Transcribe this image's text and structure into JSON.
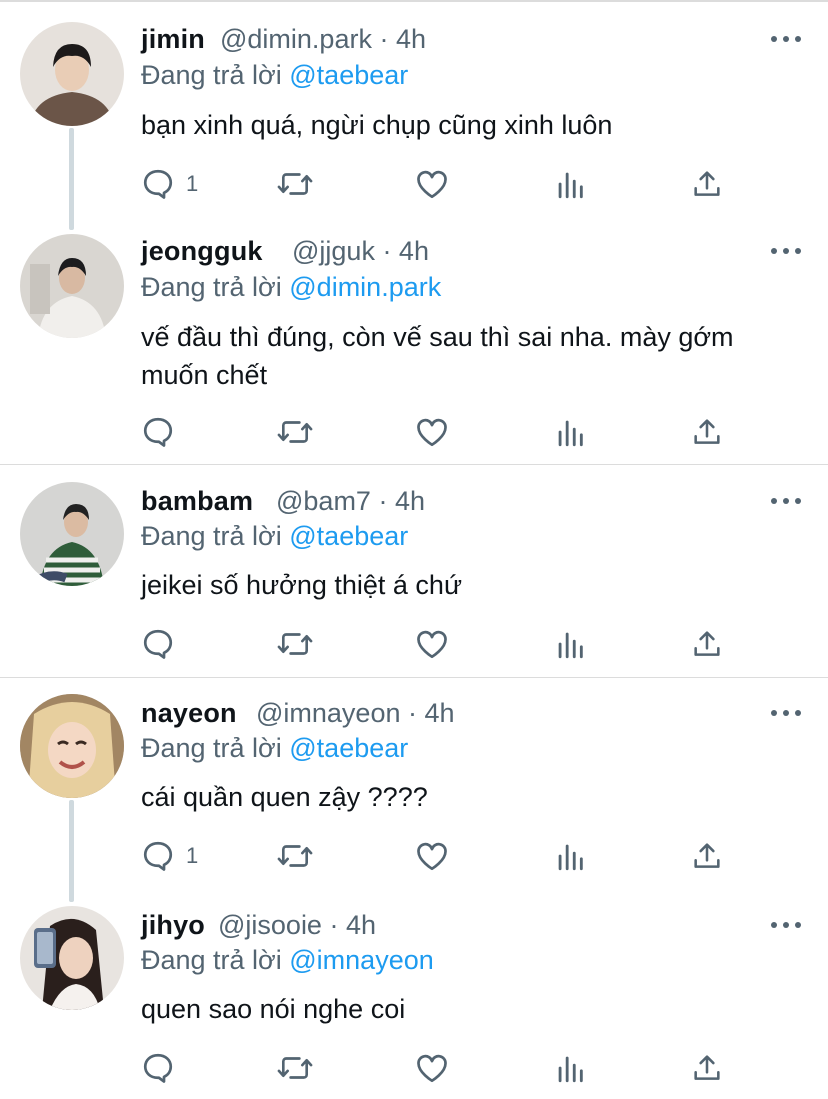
{
  "icons": {
    "more": "more-dots-icon",
    "reply": "reply-bubble-icon",
    "retweet": "retweet-icon",
    "like": "heart-icon",
    "views": "views-chart-icon",
    "share": "share-upload-icon"
  },
  "colors": {
    "mention": "#1d9bf0",
    "muted": "#536471",
    "text": "#0f1419",
    "thread_line": "#cfd9de",
    "separator": "#dcdcdc"
  },
  "tweets": [
    {
      "name": "jimin",
      "handle": "@dimin.park · 4h",
      "replying_prefix": "Đang trả lời ",
      "replying_to": "@taebear",
      "text": "bạn xinh quá, ngừi chụp cũng xinh luôn",
      "reply_count": "1"
    },
    {
      "name": "jeongguk",
      "handle": "@jjguk · 4h",
      "replying_prefix": "Đang trả lời ",
      "replying_to": "@dimin.park",
      "text": "vế đầu thì đúng, còn vế sau thì sai nha. mày gớm muốn chết",
      "reply_count": ""
    },
    {
      "name": "bambam",
      "handle": "@bam7 · 4h",
      "replying_prefix": "Đang trả lời ",
      "replying_to": "@taebear",
      "text": "jeikei số hưởng thiệt á chứ",
      "reply_count": ""
    },
    {
      "name": "nayeon",
      "handle": "@imnayeon · 4h",
      "replying_prefix": "Đang trả lời ",
      "replying_to": "@taebear",
      "text": "cái quần quen zậy ????",
      "reply_count": "1"
    },
    {
      "name": "jihyo",
      "handle": "@jisooie · 4h",
      "replying_prefix": "Đang trả lời ",
      "replying_to": "@imnayeon",
      "text": "quen sao nói nghe coi",
      "reply_count": ""
    }
  ]
}
